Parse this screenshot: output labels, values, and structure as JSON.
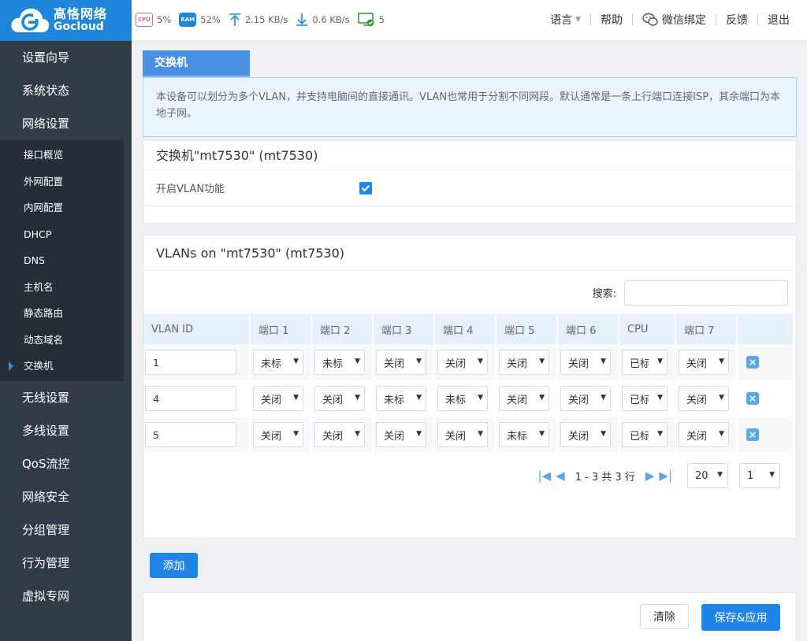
{
  "brand": {
    "name_cn": "高恪网络",
    "name_en": "Gocloud",
    "color": "#1f86dc"
  },
  "stats": {
    "cpu_label": "CPU",
    "cpu": "5%",
    "ram_label": "RAM",
    "ram": "52%",
    "upload": "2.15 KB/s",
    "download": "0.6 KB/s",
    "devices": "5"
  },
  "topnav": {
    "language": "语言",
    "help": "帮助",
    "wechat": "微信绑定",
    "feedback": "反馈",
    "logout": "退出"
  },
  "sidebar": {
    "top_items": [
      "设置向导",
      "系统状态",
      "网络设置"
    ],
    "sub_items": [
      "接口概览",
      "外网配置",
      "内网配置",
      "DHCP",
      "DNS",
      "主机名",
      "静态路由",
      "动态域名",
      "交换机"
    ],
    "active_sub": "交换机",
    "bottom_items": [
      "无线设置",
      "多线设置",
      "QoS流控",
      "网络安全",
      "分组管理",
      "行为管理",
      "虚拟专网"
    ]
  },
  "page": {
    "tab": "交换机",
    "description": "本设备可以划分为多个VLAN，并支持电脑间的直接通讯。VLAN也常用于分割不同网段。默认通常是一条上行端口连接ISP，其余端口为本地子网。",
    "switch_title": "交换机\"mt7530\" (mt7530)",
    "enable_vlan_label": "开启VLAN功能",
    "enable_vlan": true
  },
  "vlans": {
    "title": "VLANs on \"mt7530\" (mt7530)",
    "search_label": "搜索:",
    "search_value": "",
    "columns": [
      "VLAN ID",
      "端口 1",
      "端口 2",
      "端口 3",
      "端口 4",
      "端口 5",
      "端口 6",
      "CPU",
      "端口 7"
    ],
    "rows": [
      {
        "id": "1",
        "ports": [
          "未标",
          "未标",
          "关闭",
          "关闭",
          "关闭",
          "关闭",
          "已标",
          "关闭"
        ]
      },
      {
        "id": "4",
        "ports": [
          "关闭",
          "关闭",
          "未标",
          "未标",
          "关闭",
          "关闭",
          "已标",
          "关闭"
        ]
      },
      {
        "id": "5",
        "ports": [
          "关闭",
          "关闭",
          "关闭",
          "关闭",
          "未标",
          "关闭",
          "已标",
          "关闭"
        ]
      }
    ],
    "pager_text": "1 - 3 共 3 行",
    "page_size": "20",
    "page_number": "1",
    "add_label": "添加"
  },
  "footer": {
    "clear_label": "清除",
    "save_label": "保存&应用"
  }
}
